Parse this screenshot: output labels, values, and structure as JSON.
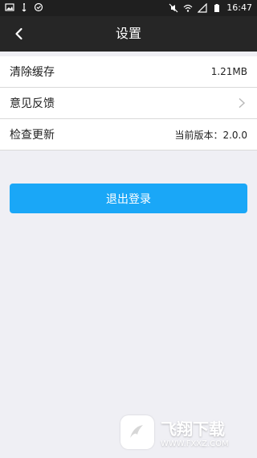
{
  "status_bar": {
    "time": "16:47",
    "left_icons": [
      "gallery-icon",
      "usb-icon",
      "check-icon"
    ],
    "right_icons": [
      "mute-icon",
      "wifi-icon",
      "signal-icon",
      "battery-icon"
    ]
  },
  "header": {
    "title": "设置",
    "back_icon": "chevron-left-icon"
  },
  "settings": {
    "items": [
      {
        "label": "清除缓存",
        "value": "1.21MB"
      },
      {
        "label": "意见反馈",
        "value": "",
        "icon": "chevron-right-icon"
      },
      {
        "label": "检查更新",
        "value": "当前版本：2.0.0"
      }
    ]
  },
  "actions": {
    "logout_label": "退出登录"
  },
  "watermark": {
    "brand_cn": "飞翔下载",
    "url": "WWW.FXXZ.COM"
  },
  "colors": {
    "status_bar_bg": "#1f1f1f",
    "topbar_bg": "#262626",
    "page_bg": "#efeff4",
    "accent": "#1aa7f7"
  }
}
